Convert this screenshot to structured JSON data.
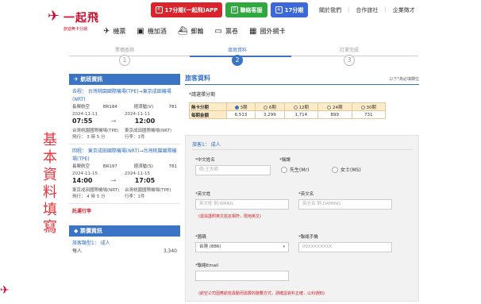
{
  "brand": {
    "mark": "✈",
    "name": "一起飛",
    "sub": "旅遊無卡分期"
  },
  "promos": [
    {
      "label": "17分期(一起飛)APP",
      "icon": "✆"
    },
    {
      "label": "聯絡客服",
      "icon": "☺"
    },
    {
      "label": "17分期",
      "icon": "⌂"
    }
  ],
  "toplinks": [
    "關於我們",
    "合作旅社",
    "企業徵才"
  ],
  "nav": [
    {
      "label": "機票",
      "icon": "✈"
    },
    {
      "label": "機加酒",
      "icon": "▣"
    },
    {
      "label": "郵輪",
      "icon": "⛴"
    },
    {
      "label": "票卷",
      "icon": "▭"
    },
    {
      "label": "國外網卡",
      "icon": "▦"
    }
  ],
  "steps": [
    {
      "num": "1",
      "label": "票價查詢"
    },
    {
      "num": "2",
      "label": "填寫資料"
    },
    {
      "num": "3",
      "label": "訂單完成"
    }
  ],
  "sidebar_vertical_text": "基本資料填寫",
  "flight_info": {
    "title": "航班資訊",
    "outbound": {
      "route": "去程： 台灣桃園國際機場(TPE)→東京成田機場(NRT)",
      "airline": "長榮航空",
      "flight_no": "BR184",
      "cabin": "經濟艙(V)",
      "aircraft": "781",
      "dep_date": "2024-11-11",
      "dep_time": "07:55",
      "arr_date": "2024-11-11",
      "arr_time": "12:00",
      "arrow": "→",
      "dep_airport": "台灣桃園國際機場(TPE)",
      "arr_airport": "東京成田國際機場(NRT)",
      "baggage": "行李：1件",
      "duration": "飛行： 3 時 5 分"
    },
    "inbound": {
      "route": "回程： 東京成田國際機場(NRT)→台灣桃園國際機場(TPE)",
      "airline": "長榮航空",
      "flight_no": "BR197",
      "cabin": "經濟艙(S)",
      "aircraft": "781",
      "dep_date": "2024-11-15",
      "dep_time": "14:00",
      "arr_date": "2024-11-15",
      "arr_time": "17:05",
      "arrow": "→",
      "dep_airport": "東京成田國際機場(NRT)",
      "arr_airport": "台灣桃園國際機場(TPE)",
      "baggage": "行李：1件",
      "duration": "飛行： 4 時 5 分"
    },
    "rules_link": "託運行李"
  },
  "fare_info": {
    "title": "票價資訊",
    "passenger_type": "旅客類型1： 成人",
    "line2": "每人",
    "line2_value": "3,340"
  },
  "passenger": {
    "section_title": "旅客資料",
    "required_note": "以下*為必填欄位"
  },
  "installment": {
    "prompt": "*請選擇分期",
    "row_label_period": "無卡分期",
    "row_label_amount": "每期金額",
    "options": [
      "3期",
      "6期",
      "12期",
      "24期",
      "30期"
    ],
    "amounts": [
      "6,513",
      "3,299",
      "1,714",
      "899",
      "731"
    ],
    "selected": "3期"
  },
  "form": {
    "traveler_title": "旅客1： 成人",
    "chinese_name_label": "*中文姓名",
    "chinese_name_placeholder": "例:王大明",
    "title_label": "*稱謂",
    "mr": "先生(Mr)",
    "ms": "女士(MS)",
    "en_last_label": "*英文姓",
    "en_last_placeholder": "英文姓 例:WANG",
    "en_first_label": "*英文名",
    "en_first_placeholder": "英文名 例:DAMING",
    "en_note": "(需與護照英文姓名相符，限用英文)",
    "country_label": "*國碼",
    "country_value": "台灣 (886)",
    "phone_label": "*聯絡手機",
    "phone_placeholder": "09XXXXXXXX",
    "email_label": "*聯絡Email",
    "bottom_note": "(航空公司因應航班異動而需要的聯繫方式，請確認資料正確，以利通知)"
  },
  "colors": {
    "brand_red": "#c8102e",
    "accent_blue": "#3b74c5",
    "promo_green": "#2fa83f",
    "table_gold": "#fdebc7"
  }
}
